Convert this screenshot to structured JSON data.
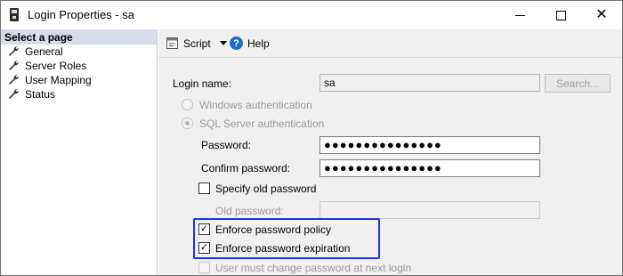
{
  "window": {
    "title": "Login Properties - sa",
    "app_icon": "server-icon",
    "min_icon": "minimize-icon",
    "max_icon": "maximize-icon",
    "close_icon": "close-icon",
    "close_glyph": "✕"
  },
  "sidebar": {
    "header": "Select a page",
    "items": [
      {
        "label": "General",
        "icon": "wrench-icon"
      },
      {
        "label": "Server Roles",
        "icon": "wrench-icon"
      },
      {
        "label": "User Mapping",
        "icon": "wrench-icon"
      },
      {
        "label": "Status",
        "icon": "wrench-icon"
      }
    ]
  },
  "toolbar": {
    "script_label": "Script",
    "help_label": "Help",
    "help_glyph": "?"
  },
  "form": {
    "login_name_label": "Login name:",
    "login_name_value": "sa",
    "search_button": "Search...",
    "windows_auth_label": "Windows authentication",
    "sql_auth_label": "SQL Server authentication",
    "password_label": "Password:",
    "password_value": "●●●●●●●●●●●●●●●",
    "confirm_password_label": "Confirm password:",
    "confirm_password_value": "●●●●●●●●●●●●●●●",
    "specify_old_password_label": "Specify old password",
    "old_password_label": "Old password:",
    "old_password_value": "",
    "enforce_policy_label": "Enforce password policy",
    "enforce_policy_checked": true,
    "enforce_expiration_label": "Enforce password expiration",
    "enforce_expiration_checked": true,
    "must_change_label": "User must change password at next login",
    "check_glyph": "✓"
  },
  "colors": {
    "sidebar_header_bg": "#d6dbe9",
    "highlight_border": "#2233dd",
    "help_icon_bg": "#1e6ec8"
  }
}
